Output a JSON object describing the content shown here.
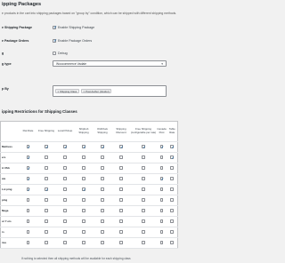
{
  "section": {
    "title": "ipping Packages",
    "description": "e products in the cart into shipping packages based on \"group by\" condition, which can be shipped with different shipping methods."
  },
  "settings": {
    "enable_packages": {
      "label": "e Shipping Package",
      "checkbox_label": "Enable Shipping Package",
      "checked": true
    },
    "enable_orders": {
      "label": "e Package Orders",
      "checkbox_label": "Enable Package Orders",
      "checked": true
    },
    "debug": {
      "label": "g",
      "checkbox_label": "Debug",
      "checked": false
    },
    "type": {
      "label": "g type",
      "value": "Woocommerce Vadaiе",
      "arrow": "▾"
    },
    "group_by": {
      "label": "p By",
      "tokens": [
        "× Shipping Class",
        "× Post Author (Vendor)"
      ]
    }
  },
  "restrictions": {
    "title": "ipping Restrictions for Shipping Classes",
    "columns": [
      "Flat Rate",
      "Free Shipping",
      "Local Pickup",
      "Shipbob Shipping",
      "OldChaix Shipping",
      "Shipping Discount",
      "Free Shipping (configurable per rate)",
      "Canada Post",
      "Table Rate"
    ],
    "rows": [
      {
        "name": "Mattress",
        "checks": [
          true,
          true,
          true,
          true,
          true,
          true,
          true,
          true,
          true
        ]
      },
      {
        "name": "ers",
        "checks": [
          true,
          false,
          false,
          false,
          false,
          false,
          false,
          false,
          true
        ]
      },
      {
        "name": "A USA",
        "checks": [
          true,
          false,
          false,
          false,
          false,
          false,
          false,
          false,
          false
        ]
      },
      {
        "name": "ate",
        "checks": [
          true,
          false,
          false,
          false,
          false,
          false,
          false,
          true,
          false
        ]
      },
      {
        "name": "Lot ping",
        "checks": [
          true,
          true,
          false,
          true,
          false,
          false,
          false,
          false,
          false
        ]
      },
      {
        "name": "ping",
        "checks": [
          false,
          false,
          false,
          false,
          false,
          false,
          false,
          false,
          false
        ]
      },
      {
        "name": "Mega",
        "checks": [
          false,
          false,
          false,
          false,
          false,
          false,
          false,
          false,
          false
        ]
      },
      {
        "name": "ur Y ers",
        "checks": [
          false,
          false,
          false,
          false,
          false,
          false,
          false,
          false,
          false
        ]
      },
      {
        "name": "rs",
        "checks": [
          false,
          false,
          false,
          false,
          false,
          false,
          false,
          false,
          false
        ]
      },
      {
        "name": "ries",
        "checks": [
          false,
          false,
          false,
          false,
          false,
          false,
          false,
          false,
          false
        ]
      }
    ],
    "footnote": "If nothing is selected then all shipping methods will be available for each shipping class"
  }
}
